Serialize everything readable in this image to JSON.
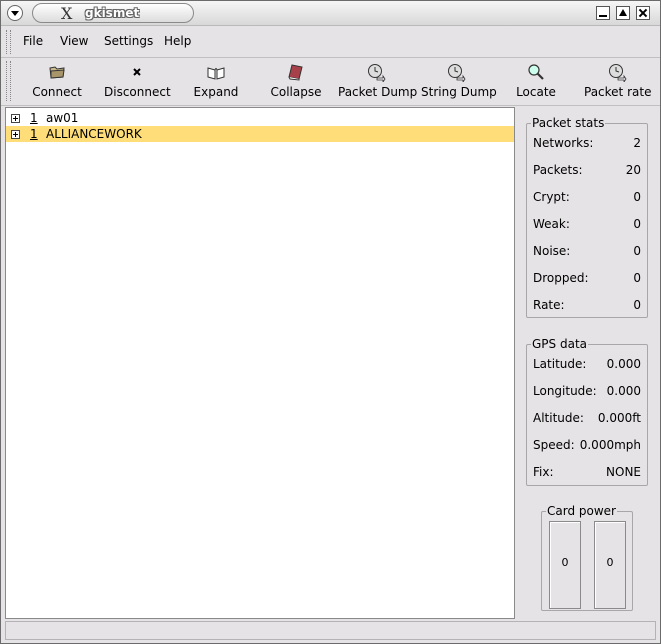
{
  "window": {
    "title": "gkismet"
  },
  "menu": [
    {
      "label": "File"
    },
    {
      "label": "View"
    },
    {
      "label": "Settings"
    },
    {
      "label": "Help"
    }
  ],
  "toolbar": [
    {
      "label": "Connect",
      "icon": "folder-icon"
    },
    {
      "label": "Disconnect",
      "icon": "x-icon"
    },
    {
      "label": "Expand",
      "icon": "open-book-icon"
    },
    {
      "label": "Collapse",
      "icon": "closed-book-icon"
    },
    {
      "label": "Packet Dump",
      "icon": "clock-arrow-icon"
    },
    {
      "label": "String Dump",
      "icon": "clock-arrow-icon"
    },
    {
      "label": "Locate",
      "icon": "magnifier-icon"
    },
    {
      "label": "Packet rate",
      "icon": "clock-arrow-icon"
    }
  ],
  "networks": [
    {
      "count": "1",
      "name": "aw01",
      "selected": false
    },
    {
      "count": "1",
      "name": "ALLIANCEWORK",
      "selected": true
    }
  ],
  "packet_stats": {
    "title": "Packet stats",
    "rows": [
      {
        "label": "Networks:",
        "value": "2"
      },
      {
        "label": "Packets:",
        "value": "20"
      },
      {
        "label": "Crypt:",
        "value": "0"
      },
      {
        "label": "Weak:",
        "value": "0"
      },
      {
        "label": "Noise:",
        "value": "0"
      },
      {
        "label": "Dropped:",
        "value": "0"
      },
      {
        "label": "Rate:",
        "value": "0"
      }
    ]
  },
  "gps_data": {
    "title": "GPS data",
    "rows": [
      {
        "label": "Latitude:",
        "value": "0.000"
      },
      {
        "label": "Longitude:",
        "value": "0.000"
      },
      {
        "label": "Altitude:",
        "value": "0.000ft"
      },
      {
        "label": "Speed:",
        "value": "0.000mph"
      },
      {
        "label": "Fix:",
        "value": "NONE"
      }
    ]
  },
  "card_power": {
    "title": "Card power",
    "values": [
      "0",
      "0"
    ]
  },
  "colors": {
    "selection": "#ffde79",
    "window_bg": "#e6e3e6"
  }
}
